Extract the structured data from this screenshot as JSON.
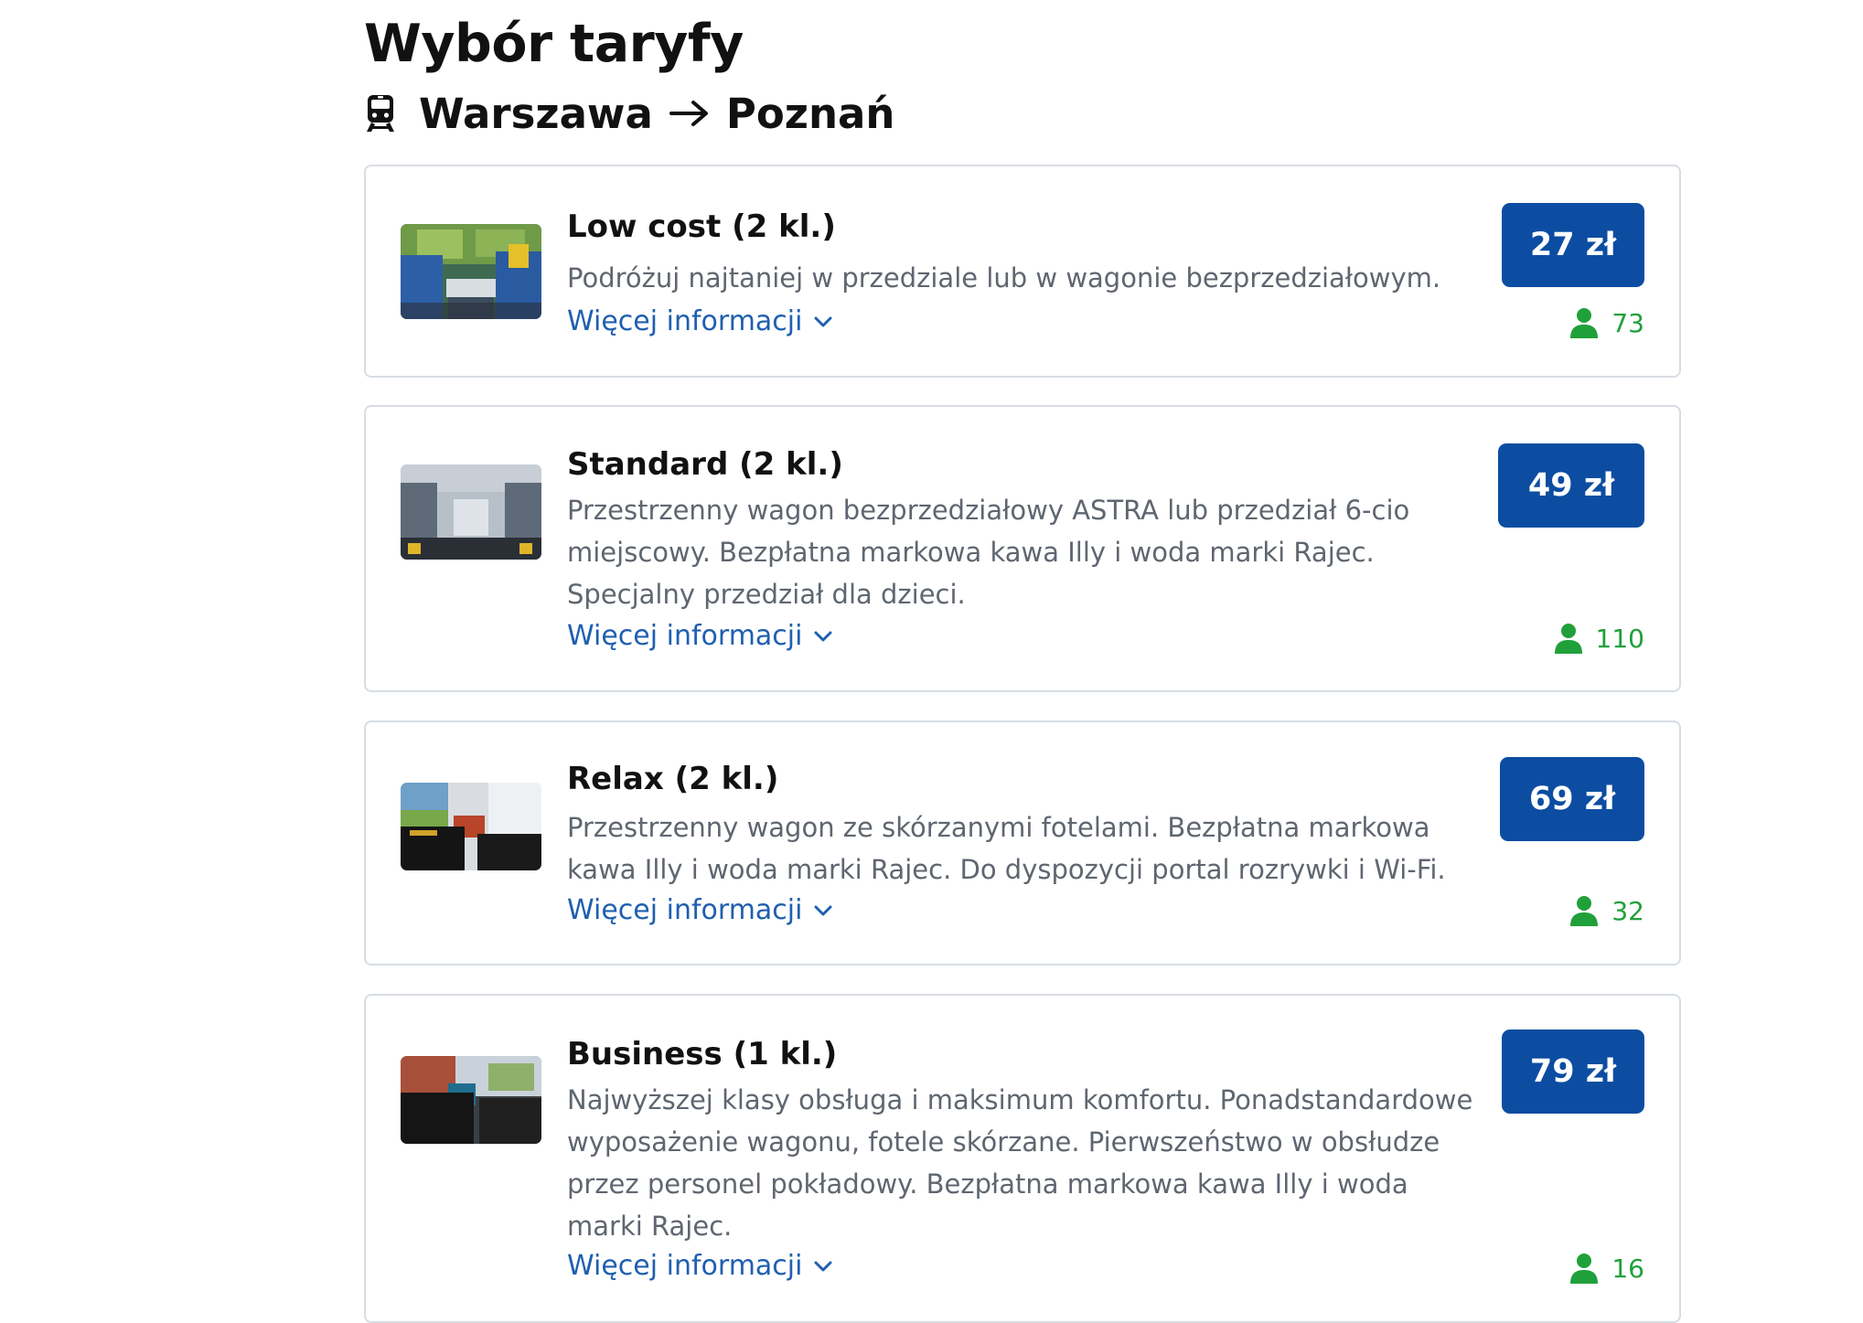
{
  "page": {
    "title": "Wybór taryfy",
    "route_from": "Warszawa",
    "route_to": "Poznań"
  },
  "icons": {
    "train": "train-icon",
    "arrow": "arrow-right-icon",
    "chevron": "chevron-down-icon",
    "person": "person-icon"
  },
  "colors": {
    "price_button": "#0c4da2",
    "link": "#1f5fb0",
    "seats": "#20a03a",
    "card_border": "#d7dde3"
  },
  "fares": [
    {
      "name": "Low cost (2 kl.)",
      "description": "Podróżuj najtaniej w przedziale lub w wagonie bezprzedziałowym.",
      "more_label": "Więcej informacji",
      "price": "27 zł",
      "seats": "73"
    },
    {
      "name": "Standard (2 kl.)",
      "description": "Przestrzenny wagon bezprzedziałowy ASTRA lub przedział 6-cio miejscowy. Bezpłatna markowa kawa Illy i woda marki Rajec. Specjalny przedział dla dzieci.",
      "more_label": "Więcej informacji",
      "price": "49 zł",
      "seats": "110"
    },
    {
      "name": "Relax (2 kl.)",
      "description": "Przestrzenny wagon ze skórzanymi fotelami. Bezpłatna markowa kawa Illy i woda marki Rajec. Do dyspozycji portal rozrywki i Wi-Fi.",
      "more_label": "Więcej informacji",
      "price": "69 zł",
      "seats": "32"
    },
    {
      "name": "Business (1 kl.)",
      "description": "Najwyższej klasy obsługa i maksimum komfortu. Ponadstandardowe wyposażenie wagonu, fotele skórzane. Pierwszeństwo w obsłudze przez personel pokładowy. Bezpłatna markowa kawa Illy i woda marki Rajec.",
      "more_label": "Więcej informacji",
      "price": "79 zł",
      "seats": "16"
    }
  ]
}
